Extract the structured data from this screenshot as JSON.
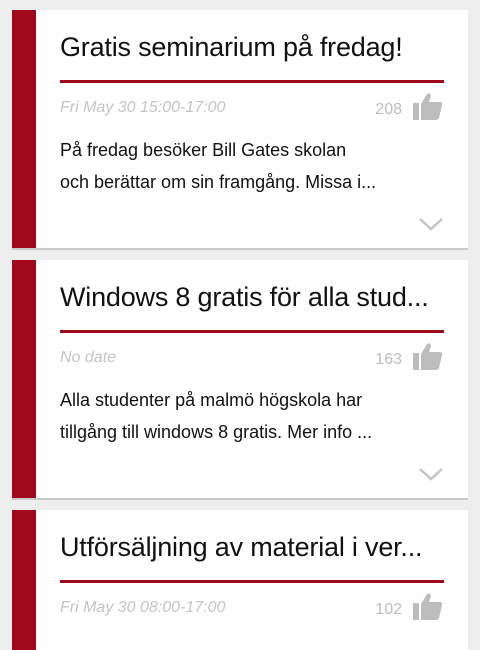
{
  "posts": [
    {
      "title": "Gratis seminarium på fredag!",
      "date": "Fri May 30 15:00-17:00",
      "likes": "208",
      "text_line1": "På fredag besöker Bill Gates skolan",
      "text_line2": "och berättar om sin framgång. Missa i...",
      "like_icon": "thumbs-up-icon",
      "expand_icon": "chevron-down-icon"
    },
    {
      "title": "Windows 8 gratis för alla stud...",
      "date": "No date",
      "likes": "163",
      "text_line1": "Alla studenter på malmö högskola har",
      "text_line2": "tillgång till windows 8 gratis. Mer info ...",
      "like_icon": "thumbs-up-icon",
      "expand_icon": "chevron-down-icon"
    },
    {
      "title": "Utförsäljning av material i ver...",
      "date": "Fri May 30 08:00-17:00",
      "likes": "102",
      "like_icon": "thumbs-up-icon"
    }
  ],
  "colors": {
    "accent": "#a10a1c",
    "background": "#eeeeee",
    "card": "#ffffff",
    "muted_text": "#c4c4c4",
    "icon": "#bdbdbd"
  }
}
